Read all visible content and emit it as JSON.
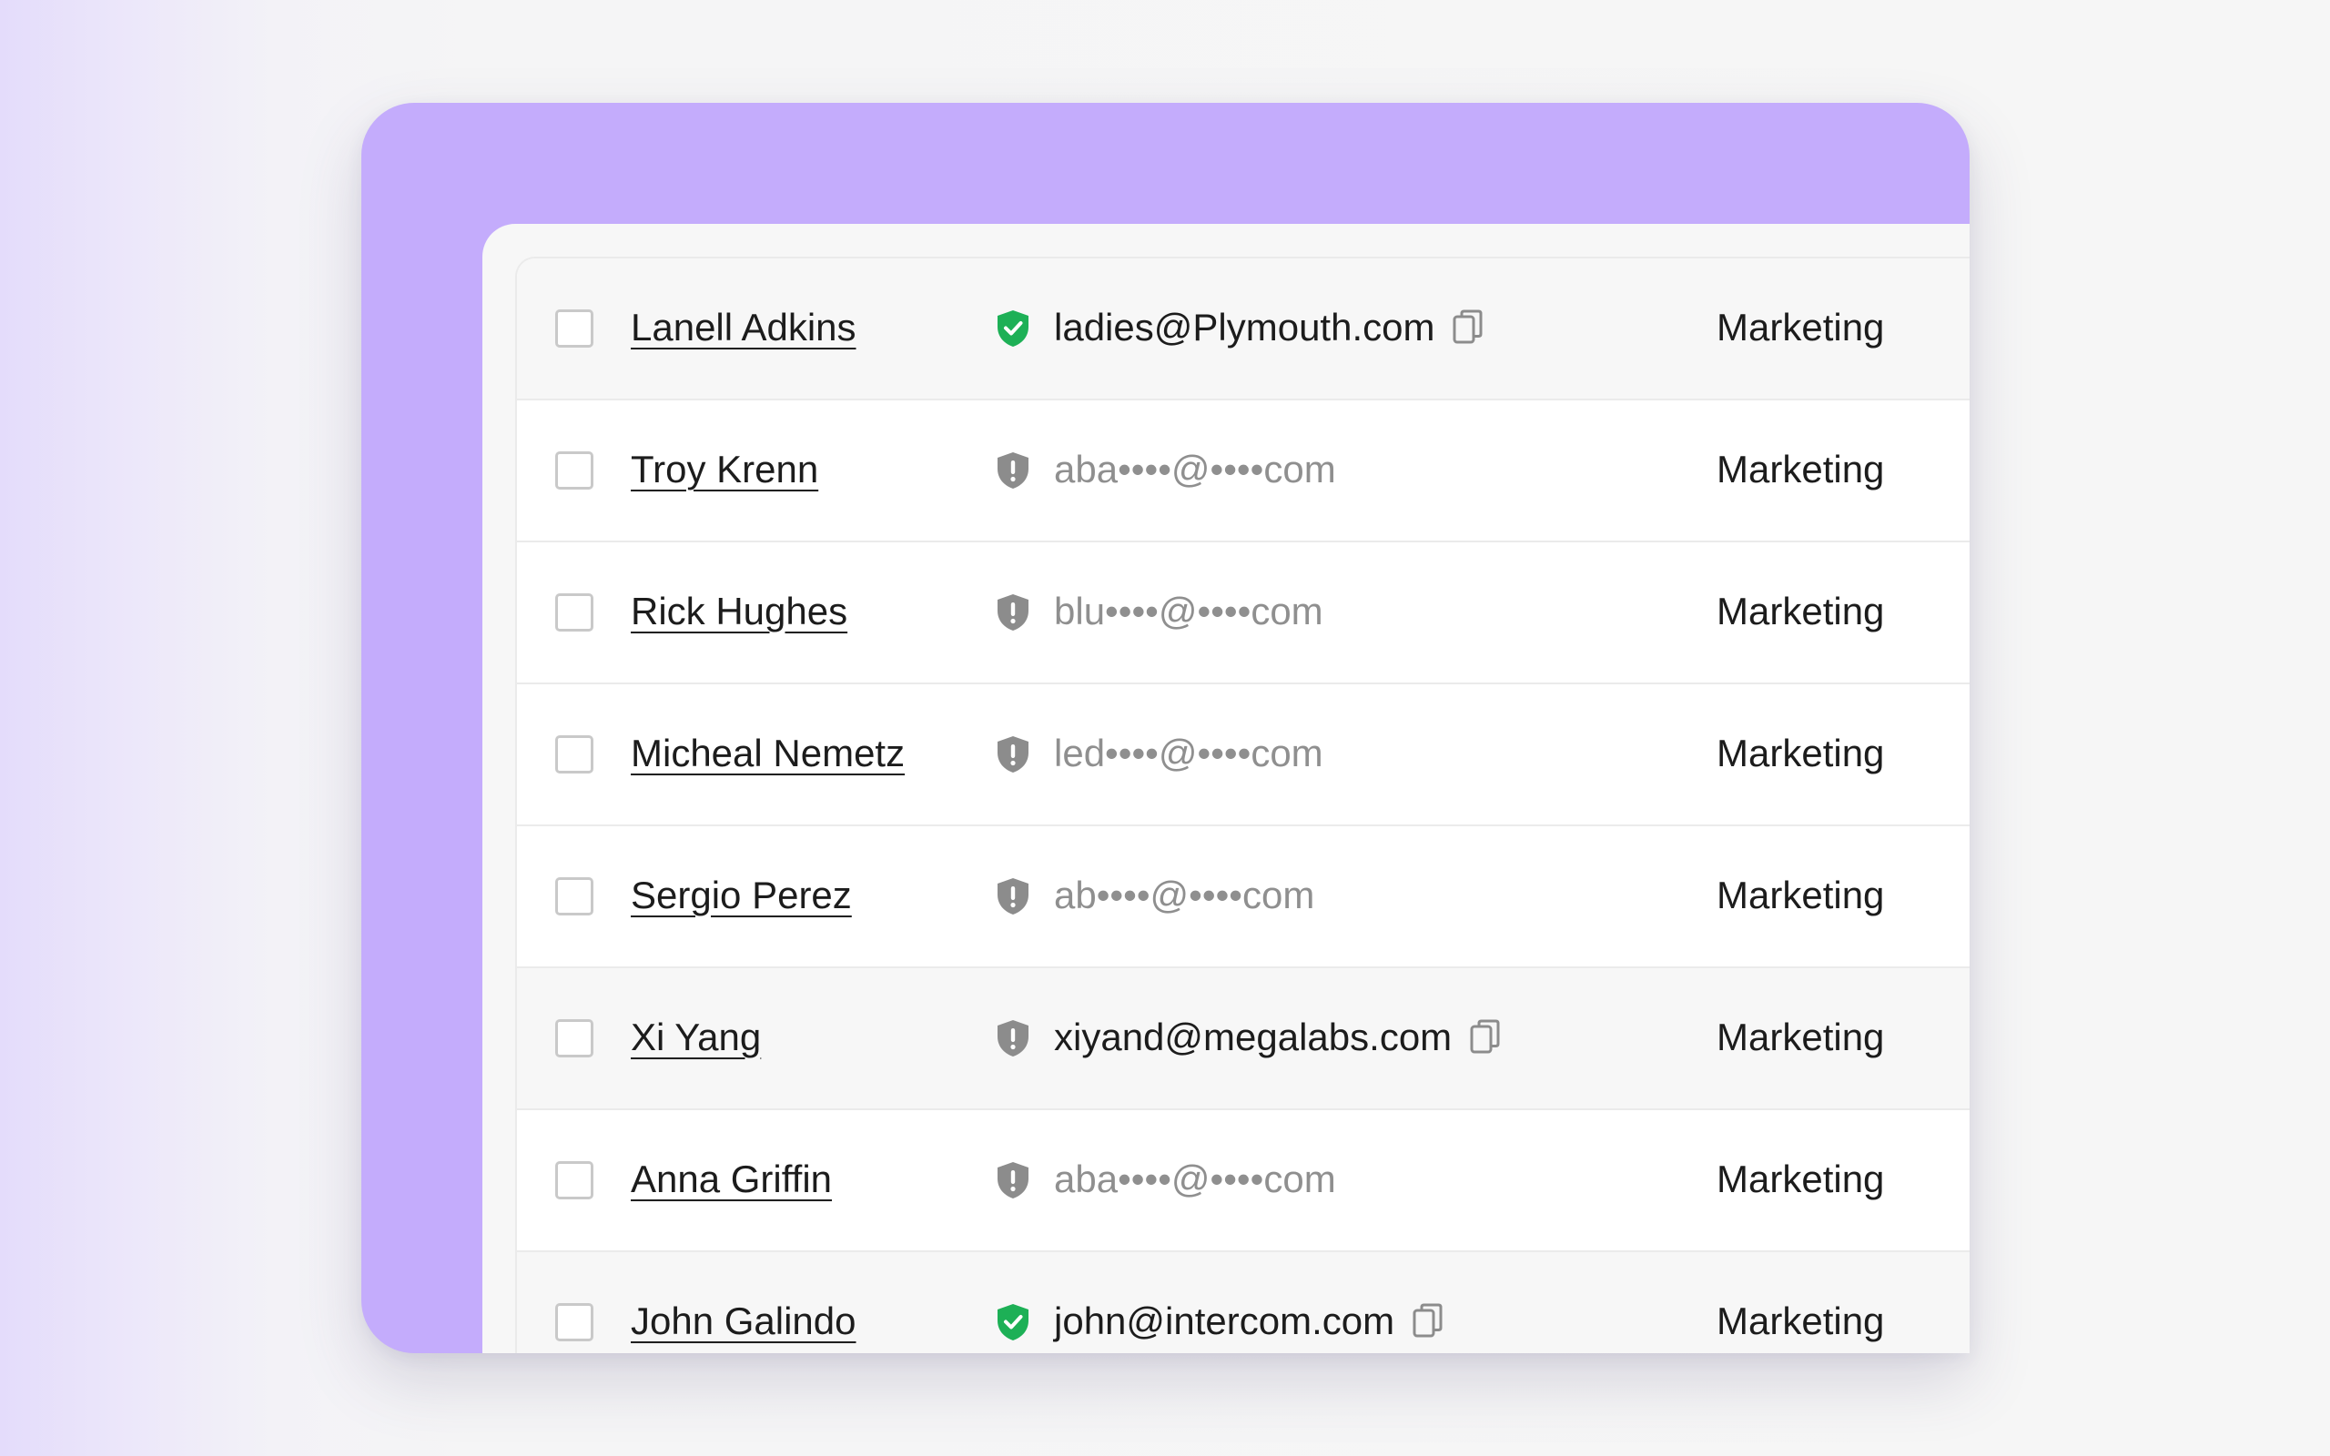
{
  "colors": {
    "accent_purple": "#c4acfc",
    "verified_green": "#1db056",
    "unverified_gray": "#8c8c8c"
  },
  "contacts": [
    {
      "name": "Lanell Adkins",
      "email": "ladies@Plymouth.com",
      "verified": true,
      "masked": false,
      "copyable": true,
      "department": "Marketing",
      "shaded": true
    },
    {
      "name": "Troy Krenn",
      "email": "aba••••@••••com",
      "verified": false,
      "masked": true,
      "copyable": false,
      "department": "Marketing",
      "shaded": false
    },
    {
      "name": "Rick Hughes",
      "email": "blu••••@••••com",
      "verified": false,
      "masked": true,
      "copyable": false,
      "department": "Marketing",
      "shaded": false
    },
    {
      "name": "Micheal Nemetz",
      "email": "led••••@••••com",
      "verified": false,
      "masked": true,
      "copyable": false,
      "department": "Marketing",
      "shaded": false
    },
    {
      "name": "Sergio Perez",
      "email": "ab••••@••••com",
      "verified": false,
      "masked": true,
      "copyable": false,
      "department": "Marketing",
      "shaded": false
    },
    {
      "name": "Xi Yang",
      "email": "xiyand@megalabs.com",
      "verified": false,
      "masked": false,
      "copyable": true,
      "department": "Marketing",
      "shaded": true
    },
    {
      "name": "Anna Griffin",
      "email": "aba••••@••••com",
      "verified": false,
      "masked": true,
      "copyable": false,
      "department": "Marketing",
      "shaded": false
    },
    {
      "name": "John Galindo",
      "email": "john@intercom.com",
      "verified": true,
      "masked": false,
      "copyable": true,
      "department": "Marketing",
      "shaded": true
    }
  ]
}
